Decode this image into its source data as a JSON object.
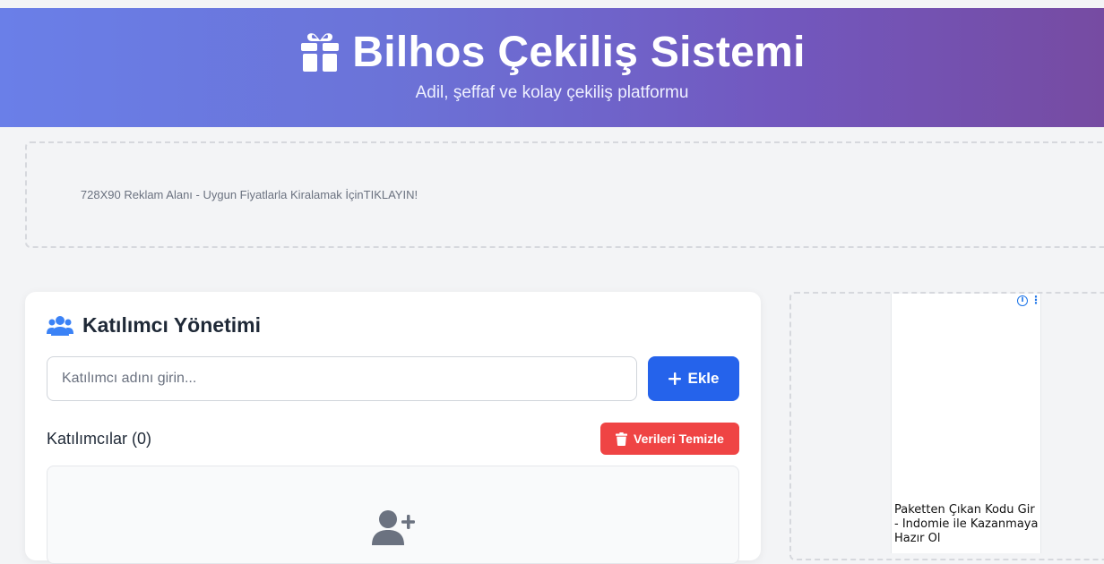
{
  "header": {
    "title": "Bilhos Çekiliş Sistemi",
    "subtitle": "Adil, şeffaf ve kolay çekiliş platformu",
    "icon": "gift-icon"
  },
  "ad_top": {
    "text": "728X90 Reklam Alanı - Uygun Fiyatlarla Kiralamak İçinTIKLAYIN!"
  },
  "participants": {
    "title": "Katılımcı Yönetimi",
    "icon": "users-icon",
    "input_placeholder": "Katılımcı adını girin...",
    "input_value": "",
    "add_label": "Ekle",
    "list_label": "Katılımcılar (0)",
    "clear_label": "Verileri Temizle",
    "empty_icon": "user-plus-icon"
  },
  "ad_side": {
    "text": "Paketten Çıkan Kodu Gir - Indomie ile Kazanmaya Hazır Ol",
    "info_icon": "info-icon",
    "menu_icon": "more-vertical-icon"
  },
  "colors": {
    "primary": "#2563eb",
    "danger": "#ef4444",
    "header_start": "#667eea",
    "header_end": "#764ba2"
  }
}
